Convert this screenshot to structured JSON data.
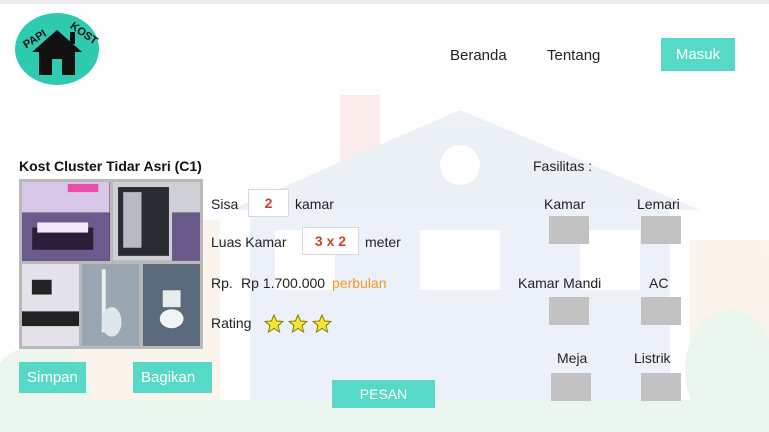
{
  "header": {
    "logo_text": "PAPI KOST",
    "nav": [
      "Beranda",
      "Tentang"
    ],
    "login_label": "Masuk"
  },
  "listing": {
    "title": "Kost Cluster Tidar Asri (C1)",
    "sisa_label": "Sisa",
    "sisa_value": "2",
    "sisa_unit": "kamar",
    "luas_label": "Luas Kamar",
    "luas_value": "3 x 2",
    "luas_unit": "meter",
    "price_label": "Rp.",
    "price_value": "Rp 1.700.000",
    "price_period": "perbulan",
    "rating_label": "Rating",
    "rating_stars": 3,
    "save_label": "Simpan",
    "share_label": "Bagikan",
    "order_label": "PESAN"
  },
  "facilities": {
    "title": "Fasilitas :",
    "items": [
      "Kamar",
      "Lemari",
      "Kamar Mandi",
      "AC",
      "Meja",
      "Listrik"
    ]
  },
  "colors": {
    "accent": "#56d9c6",
    "logo_bg": "#2ecbb0",
    "value_text": "#d0412b",
    "period_text": "#f39a2c",
    "facility_box": "#c2c2c2"
  }
}
